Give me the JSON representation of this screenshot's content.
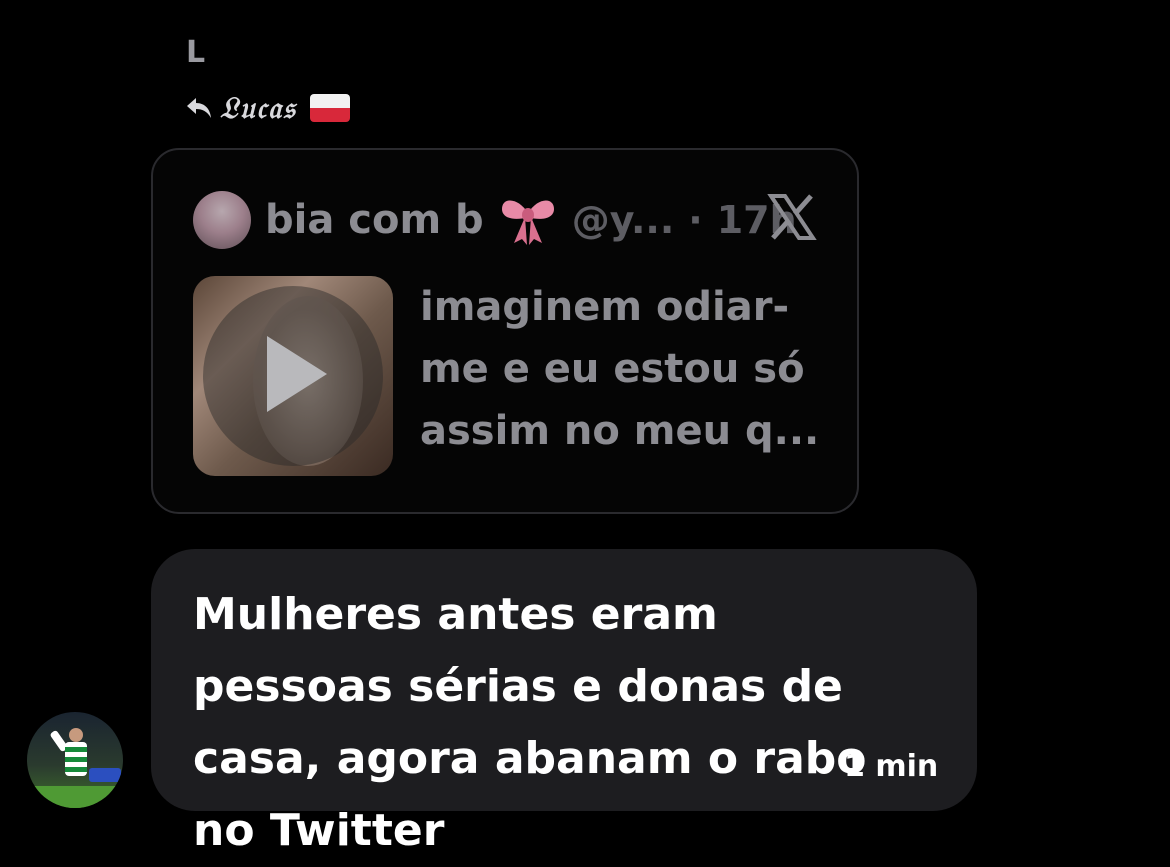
{
  "message": {
    "sender_initial": "L",
    "reply_to": {
      "name": "𝔏𝔲𝔠𝔞𝔰",
      "flag": "poland-flag-icon"
    },
    "shared_tweet": {
      "author": "bia com b",
      "emoji": "🎀",
      "handle": "@y...",
      "separator": "·",
      "time": "17h",
      "text": "imaginem odiar-me e eu estou só assim no meu q...",
      "media": "video-thumbnail",
      "source_logo": "x-logo-icon"
    },
    "text": "Mulheres antes eram pessoas sérias e donas de casa, agora abanam o rabo no Twitter",
    "timestamp": "1 min"
  },
  "colors": {
    "background": "#000000",
    "bubble": "#1d1d20",
    "card_border": "#2a2a2e",
    "muted_text": "#8c8c92",
    "dim_text": "#5d5d63",
    "flag_red": "#d8283a"
  }
}
